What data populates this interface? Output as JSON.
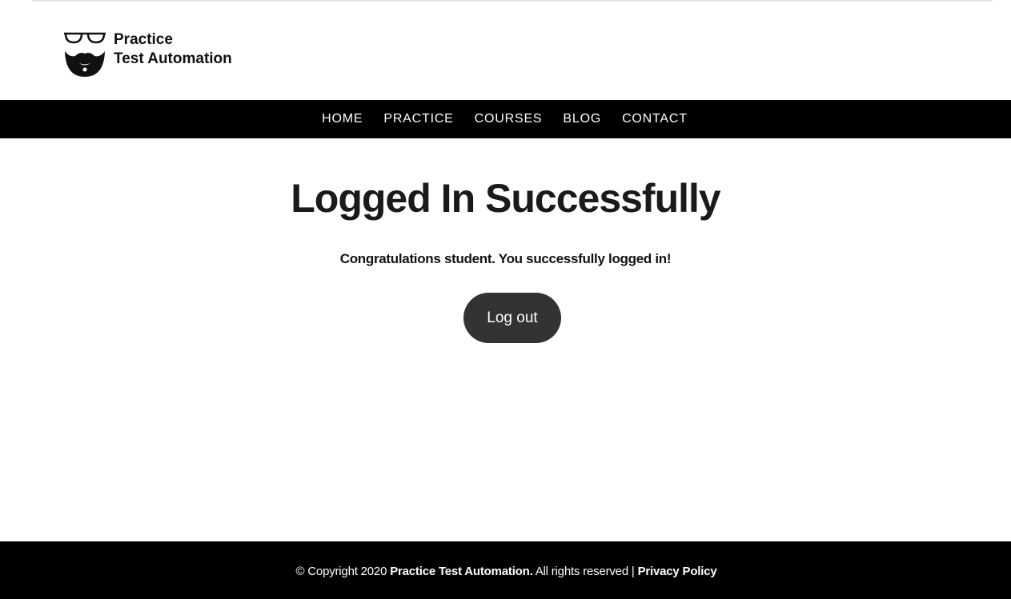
{
  "brand": {
    "line1": "Practice",
    "line2": "Test Automation"
  },
  "nav": {
    "items": [
      {
        "label": "HOME"
      },
      {
        "label": "PRACTICE"
      },
      {
        "label": "COURSES"
      },
      {
        "label": "BLOG"
      },
      {
        "label": "CONTACT"
      }
    ]
  },
  "main": {
    "title": "Logged In Successfully",
    "message": "Congratulations student. You successfully logged in!",
    "logout_label": "Log out"
  },
  "footer": {
    "copyright": "© Copyright 2020 ",
    "company": "Practice Test Automation.",
    "rights": " All rights reserved | ",
    "privacy_label": "Privacy Policy"
  },
  "colors": {
    "nav_background": "#000000",
    "button_background": "#333333",
    "footer_background": "#000000"
  },
  "icons": {
    "logo": "glasses-beard-logo-icon"
  }
}
